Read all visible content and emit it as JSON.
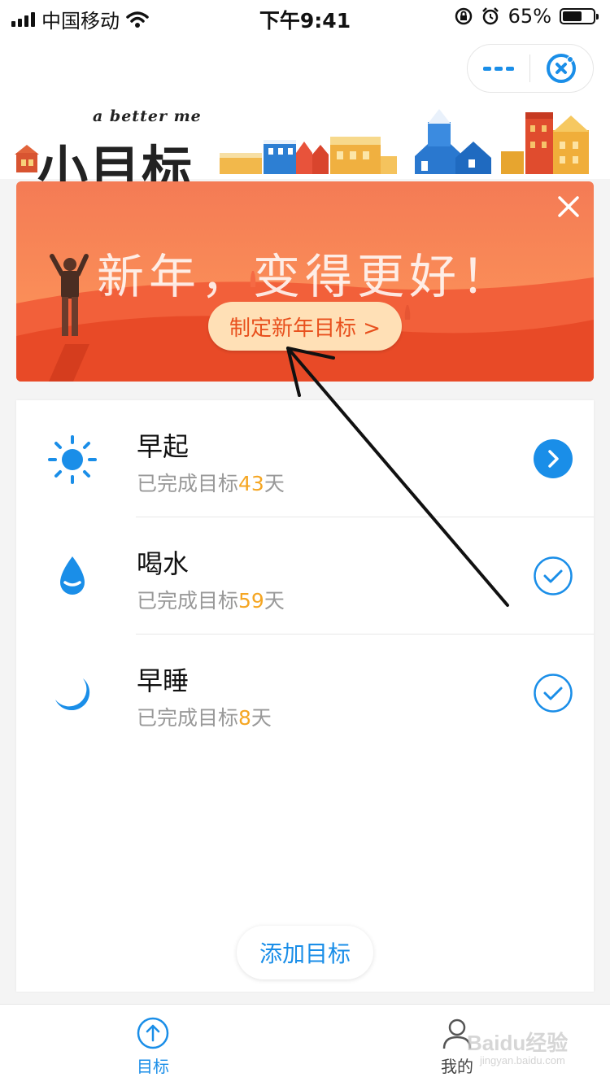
{
  "status_bar": {
    "carrier": "中国移动",
    "time": "下午9:41",
    "battery_percent": "65%",
    "battery_level": 0.65
  },
  "header": {
    "logo_subtitle": "a better me",
    "logo_title": "小目标"
  },
  "banner": {
    "title": "新年，变得更好！",
    "cta_label": "制定新年目标 >"
  },
  "goals": [
    {
      "name": "早起",
      "prefix": "已完成目标",
      "days": "43",
      "suffix": "天",
      "icon": "sun-icon",
      "status": "next"
    },
    {
      "name": "喝水",
      "prefix": "已完成目标",
      "days": "59",
      "suffix": "天",
      "icon": "water-drop-icon",
      "status": "done"
    },
    {
      "name": "早睡",
      "prefix": "已完成目标",
      "days": "8",
      "suffix": "天",
      "icon": "moon-icon",
      "status": "done"
    }
  ],
  "add_goal_label": "添加目标",
  "tabs": [
    {
      "label": "目标",
      "icon": "arrow-up-circle-icon",
      "active": true
    },
    {
      "label": "我的",
      "icon": "person-icon",
      "active": false
    }
  ],
  "watermark": {
    "text": "Baidu经验",
    "sub": "jingyan.baidu.com"
  },
  "colors": {
    "accent": "#1a8ee8",
    "highlight": "#f5a623",
    "banner": "#f0522a",
    "cta_bg": "#ffe0b6"
  }
}
